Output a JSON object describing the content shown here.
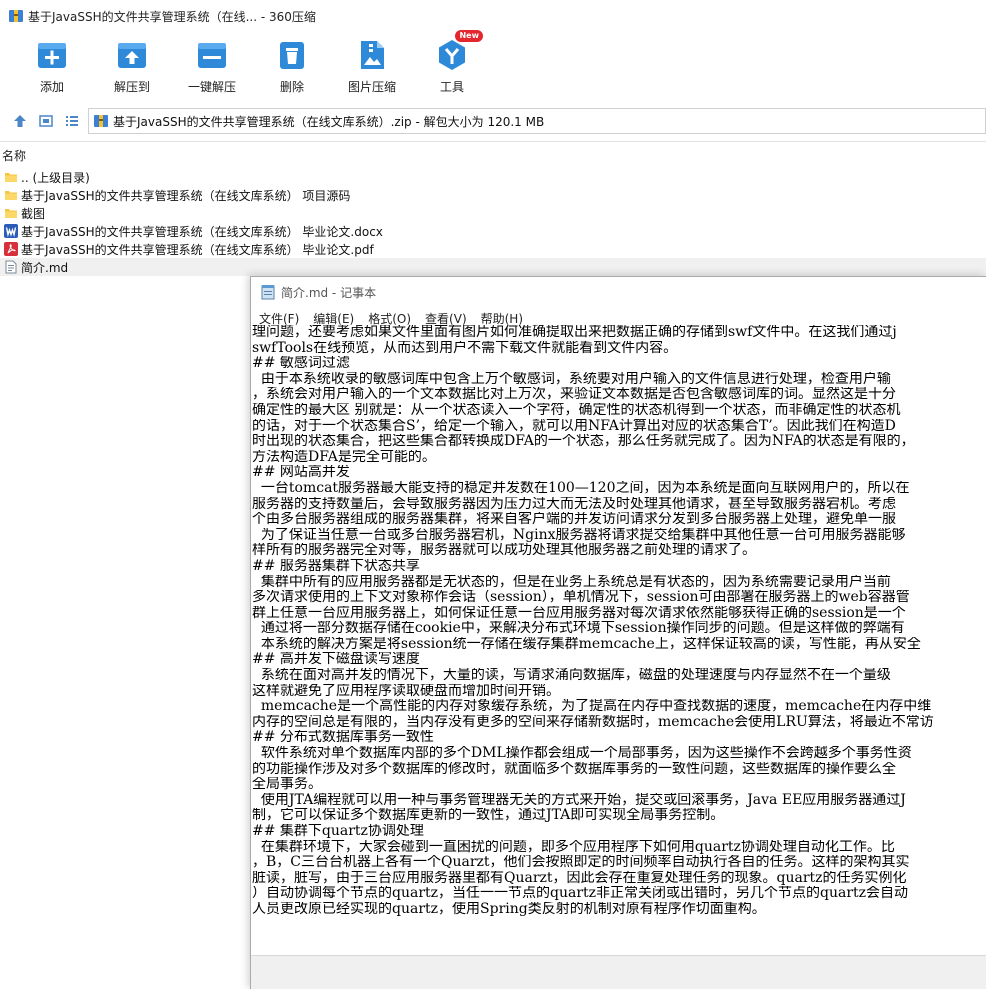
{
  "window": {
    "title": "基于JavaSSH的文件共享管理系统（在线... - 360压缩"
  },
  "toolbar": {
    "items": [
      {
        "label": "添加",
        "icon": "add-icon"
      },
      {
        "label": "解压到",
        "icon": "extract-to-icon"
      },
      {
        "label": "一键解压",
        "icon": "one-click-extract-icon"
      },
      {
        "label": "删除",
        "icon": "delete-icon"
      },
      {
        "label": "图片压缩",
        "icon": "image-compress-icon"
      },
      {
        "label": "工具",
        "icon": "tools-icon",
        "badge": "New"
      }
    ]
  },
  "address": {
    "path": "基于JavaSSH的文件共享管理系统（在线文库系统）.zip - 解包大小为 120.1 MB"
  },
  "list": {
    "header": "名称",
    "items": [
      {
        "name": ".. (上级目录)",
        "type": "folder"
      },
      {
        "name": "基于JavaSSH的文件共享管理系统（在线文库系统） 项目源码",
        "type": "folder"
      },
      {
        "name": "截图",
        "type": "folder"
      },
      {
        "name": "基于JavaSSH的文件共享管理系统（在线文库系统） 毕业论文.docx",
        "type": "word"
      },
      {
        "name": "基于JavaSSH的文件共享管理系统（在线文库系统） 毕业论文.pdf",
        "type": "pdf"
      },
      {
        "name": "简介.md",
        "type": "text"
      }
    ]
  },
  "notepad": {
    "title": "简介.md - 记事本",
    "menu": [
      "文件(F)",
      "编辑(E)",
      "格式(O)",
      "查看(V)",
      "帮助(H)"
    ],
    "lines": [
      "理问题，还要考虑如果文件里面有图片如何准确提取出来把数据正确的存储到swf文件中。在这我们通过j",
      "swfTools在线预览，从而达到用户不需下载文件就能看到文件内容。",
      "## 敏感词过滤",
      "  由于本系统收录的敏感词库中包含上万个敏感词，系统要对用户输入的文件信息进行处理，检查用户输",
      "，系统会对用户输入的一个文本数据比对上万次，来验证文本数据是否包含敏感词库的词。显然这是十分",
      "确定性的最大区 别就是：从一个状态读入一个字符，确定性的状态机得到一个状态，而非确定性的状态机",
      "的话，对于一个状态集合S’，给定一个输入，就可以用NFA计算出对应的状态集合T’。因此我们在构造D",
      "时出现的状态集合，把这些集合都转换成DFA的一个状态，那么任务就完成了。因为NFA的状态是有限的，",
      "方法构造DFA是完全可能的。",
      "## 网站高并发",
      "  一台tomcat服务器最大能支持的稳定并发数在100—120之间，因为本系统是面向互联网用户的，所以在",
      "服务器的支持数量后，会导致服务器因为压力过大而无法及时处理其他请求，甚至导致服务器宕机。考虑",
      "个由多台服务器组成的服务器集群，将来自客户端的并发访问请求分发到多台服务器上处理，避免单一服",
      "  为了保证当任意一台或多台服务器宕机，Nginx服务器将请求提交给集群中其他任意一台可用服务器能够",
      "样所有的服务器完全对等，服务器就可以成功处理其他服务器之前处理的请求了。",
      "## 服务器集群下状态共享",
      "  集群中所有的应用服务器都是无状态的，但是在业务上系统总是有状态的，因为系统需要记录用户当前",
      "多次请求使用的上下文对象称作会话（session），单机情况下，session可由部署在服务器上的web容器管",
      "群上任意一台应用服务器上，如何保证任意一台应用服务器对每次请求依然能够获得正确的session是一个",
      "  通过将一部分数据存储在cookie中，来解决分布式环境下session操作同步的问题。但是这样做的弊端有",
      "  本系统的解决方案是将session统一存储在缓存集群memcache上，这样保证较高的读，写性能，再从安全",
      "## 高并发下磁盘读写速度",
      "  系统在面对高并发的情况下，大量的读，写请求涌向数据库，磁盘的处理速度与内存显然不在一个量级",
      "这样就避免了应用程序读取硬盘而增加时间开销。",
      "  memcache是一个高性能的内存对象缓存系统，为了提高在内存中查找数据的速度，memcache在内存中维",
      "内存的空间总是有限的，当内存没有更多的空间来存储新数据时，memcache会使用LRU算法，将最近不常访",
      "## 分布式数据库事务一致性",
      "  软件系统对单个数据库内部的多个DML操作都会组成一个局部事务，因为这些操作不会跨越多个事务性资",
      "的功能操作涉及对多个数据库的修改时，就面临多个数据库事务的一致性问题，这些数据库的操作要么全",
      "全局事务。",
      "  使用JTA编程就可以用一种与事务管理器无关的方式来开始，提交或回滚事务，Java EE应用服务器通过J",
      "制，它可以保证多个数据库更新的一致性，通过JTA即可实现全局事务控制。",
      "## 集群下quartz协调处理",
      "  在集群环境下，大家会碰到一直困扰的问题，即多个应用程序下如何用quartz协调处理自动化工作。比",
      "，B，C三台台机器上各有一个Quarzt，他们会按照即定的时间频率自动执行各自的任务。这样的架构其实",
      "脏读，脏写，由于三台应用服务器里都有Quarzt，因此会存在重复处理任务的现象。quartz的任务实例化",
      "）自动协调每个节点的quartz，当任一一节点的quartz非正常关闭或出错时，另几个节点的quartz会自动",
      "人员更改原已经实现的quartz，使用Spring类反射的机制对原有程序作切面重构。"
    ]
  }
}
